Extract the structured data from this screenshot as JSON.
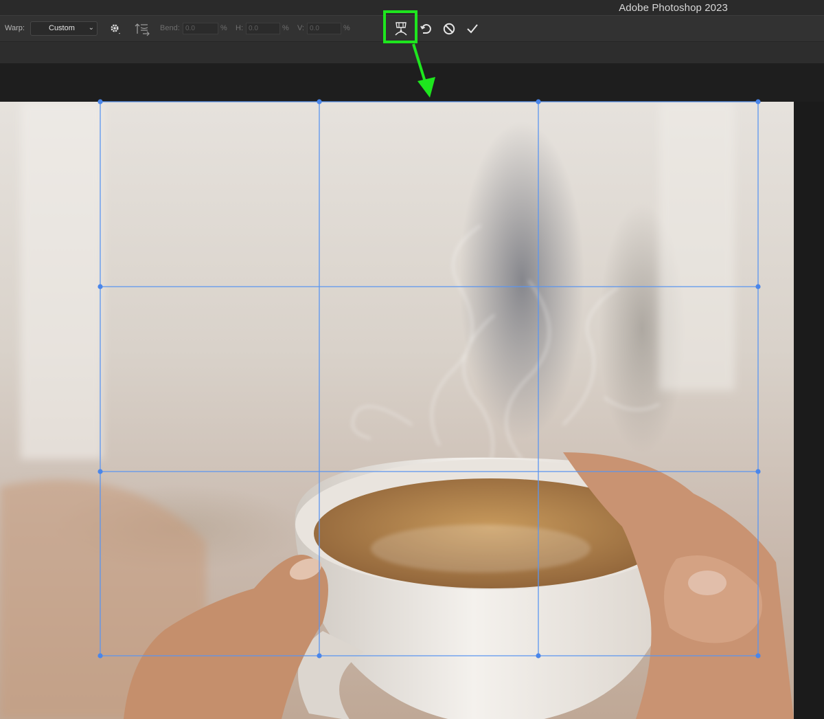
{
  "window": {
    "app_title": "Adobe Photoshop 2023"
  },
  "options_bar": {
    "warp_label": "Warp:",
    "warp_value": "Custom",
    "bend_label": "Bend:",
    "bend_value": "0.0",
    "bend_unit": "%",
    "h_label": "H:",
    "h_value": "0.0",
    "h_unit": "%",
    "v_label": "V:",
    "v_value": "0.0",
    "v_unit": "%",
    "icons": [
      "warp-options-gear-icon",
      "change-warp-orientation-icon",
      "toggle-warp-orientation-icon",
      "reset-warp-icon",
      "cancel-transform-icon",
      "commit-transform-icon"
    ]
  },
  "annotation": {
    "highlight_color": "#1ee61e"
  },
  "warp_grid": {
    "color": "#5a95f0",
    "rows": 3,
    "columns": 3
  }
}
